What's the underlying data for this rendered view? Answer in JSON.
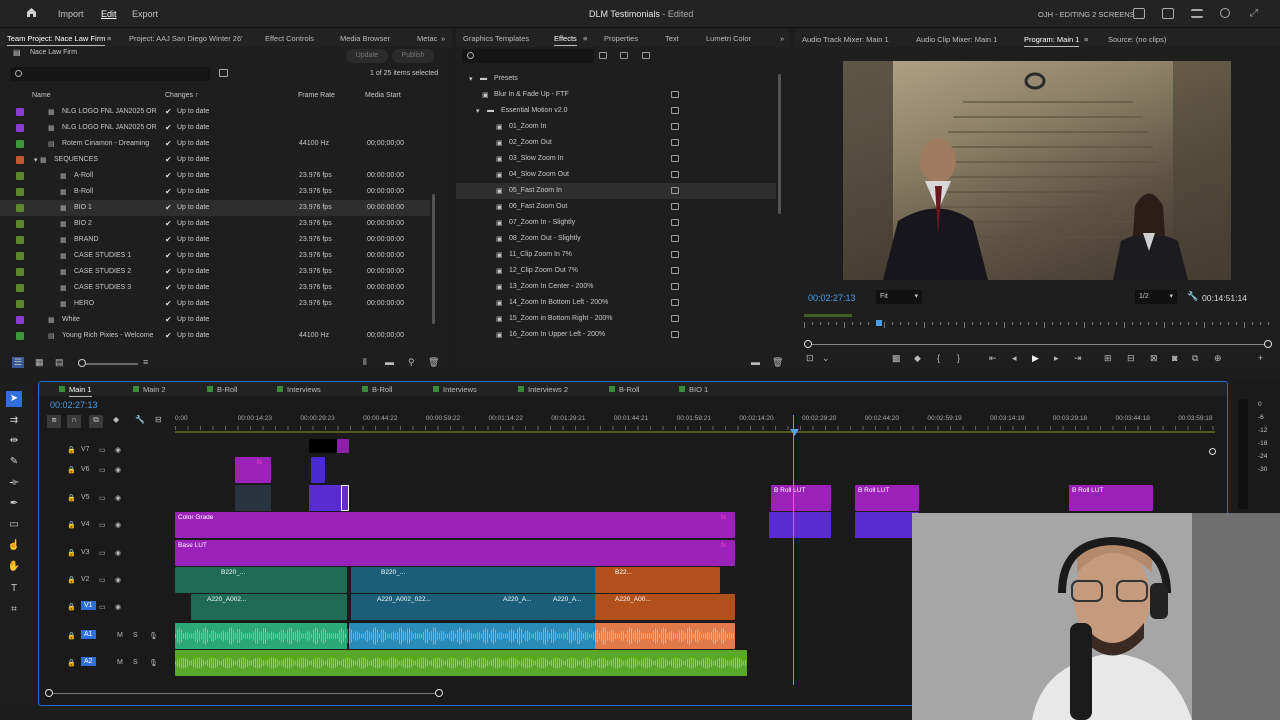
{
  "app": {
    "title": "DLM Testimonials",
    "status": "- Edited",
    "workspace": "OJH - EDITING 2 SCREENS",
    "menu": [
      "Import",
      "Edit",
      "Export"
    ],
    "active_menu": "Edit"
  },
  "project": {
    "tabs": [
      "Team Project: Nace Law Firm",
      "Project: AAJ San Diego Winter 26'",
      "Effect Controls",
      "Media Browser",
      "Metac"
    ],
    "name": "Nace Law Firm",
    "update_label": "Update",
    "publish_label": "Publish",
    "items_selected": "1 of 25 items selected",
    "columns": [
      "Name",
      "Changes",
      "Frame Rate",
      "Media Start"
    ],
    "rows": [
      {
        "name": "NLG LOGO FNL JAN2025 OR",
        "changes": "Up to date",
        "rate": "",
        "start": "",
        "color": "#8a3bd0",
        "indent": 1
      },
      {
        "name": "NLG LOGO FNL JAN2025 OR",
        "changes": "Up to date",
        "rate": "",
        "start": "",
        "color": "#8a3bd0",
        "indent": 1
      },
      {
        "name": "Rotem Cinamon - Dreaming",
        "changes": "Up to date",
        "rate": "44100 Hz",
        "start": "00;00;00;00",
        "color": "#3a9a3a",
        "indent": 1
      },
      {
        "name": "SEQUENCES",
        "changes": "Up to date",
        "rate": "",
        "start": "",
        "color": "#c05a2a",
        "indent": 0
      },
      {
        "name": "A-Roll",
        "changes": "Up to date",
        "rate": "23.976 fps",
        "start": "00:00:00:00",
        "color": "#5a8a2a",
        "indent": 2
      },
      {
        "name": "B-Roll",
        "changes": "Up to date",
        "rate": "23.976 fps",
        "start": "00:00:00:00",
        "color": "#5a8a2a",
        "indent": 2
      },
      {
        "name": "BIO 1",
        "changes": "Up to date",
        "rate": "23.976 fps",
        "start": "00:00:00:00",
        "color": "#5a8a2a",
        "indent": 2
      },
      {
        "name": "BIO 2",
        "changes": "Up to date",
        "rate": "23.976 fps",
        "start": "00:00:00:00",
        "color": "#5a8a2a",
        "indent": 2
      },
      {
        "name": "BRAND",
        "changes": "Up to date",
        "rate": "23.976 fps",
        "start": "00:00:00:00",
        "color": "#5a8a2a",
        "indent": 2
      },
      {
        "name": "CASE STUDIES 1",
        "changes": "Up to date",
        "rate": "23.976 fps",
        "start": "00:00:00:00",
        "color": "#5a8a2a",
        "indent": 2
      },
      {
        "name": "CASE STUDIES 2",
        "changes": "Up to date",
        "rate": "23.976 fps",
        "start": "00:00:00:00",
        "color": "#5a8a2a",
        "indent": 2
      },
      {
        "name": "CASE STUDIES 3",
        "changes": "Up to date",
        "rate": "23.976 fps",
        "start": "00:00:00:00",
        "color": "#5a8a2a",
        "indent": 2
      },
      {
        "name": "HERO",
        "changes": "Up to date",
        "rate": "23.976 fps",
        "start": "00:00:00:00",
        "color": "#5a8a2a",
        "indent": 2
      },
      {
        "name": "White",
        "changes": "Up to date",
        "rate": "",
        "start": "",
        "color": "#8a3bd0",
        "indent": 1
      },
      {
        "name": "Young Rich Pixies - Welcome",
        "changes": "Up to date",
        "rate": "44100 Hz",
        "start": "00;00;00;00",
        "color": "#3a9a3a",
        "indent": 1
      }
    ]
  },
  "effects": {
    "tabs": [
      "Graphics Templates",
      "Effects",
      "Properties",
      "Text",
      "Lumetri Color"
    ],
    "presets_label": "Presets",
    "items": [
      {
        "name": "Blur In & Fade Up - FTF",
        "level": 1
      },
      {
        "name": "Essential Motion v2.0",
        "level": 1
      },
      {
        "name": "01_Zoom In",
        "level": 2
      },
      {
        "name": "02_Zoom Out",
        "level": 2
      },
      {
        "name": "03_Slow Zoom In",
        "level": 2
      },
      {
        "name": "04_Slow Zoom Out",
        "level": 2
      },
      {
        "name": "05_Fast Zoom In",
        "level": 2
      },
      {
        "name": "06_Fast Zoom Out",
        "level": 2
      },
      {
        "name": "07_Zoom In - Slightly",
        "level": 2
      },
      {
        "name": "08_Zoom Out - Slightly",
        "level": 2
      },
      {
        "name": "11_Clip Zoom In 7%",
        "level": 2
      },
      {
        "name": "12_Clip Zoom Out 7%",
        "level": 2
      },
      {
        "name": "13_Zoom In Center - 200%",
        "level": 2
      },
      {
        "name": "14_Zoom In Bottom Left - 200%",
        "level": 2
      },
      {
        "name": "15_Zoom in Bottom Right - 200%",
        "level": 2
      },
      {
        "name": "16_Zoom In Upper Left - 200%",
        "level": 2
      }
    ]
  },
  "program": {
    "tabs": [
      "Audio Track Mixer: Main 1",
      "Audio Clip Mixer: Main 1",
      "Program: Main 1",
      "Source: (no clips)"
    ],
    "timecode": "00:02:27:13",
    "fit": "Fit",
    "resolution": "1/2",
    "duration": "00:14:51:14"
  },
  "timeline": {
    "tabs": [
      "Main 1",
      "Main 2",
      "B-Roll",
      "Interviews",
      "B-Roll",
      "Interviews",
      "Interviews 2",
      "B-Roll",
      "BIO 1"
    ],
    "timecode": "00:02:27:13",
    "ruler": [
      "0:00",
      "00:00:14:23",
      "00:00:29:23",
      "00:00:44:22",
      "00:00:59:22",
      "00:01:14:22",
      "00:01:29:21",
      "00:01:44:21",
      "00:01:59:21",
      "00:02:14:20",
      "00:02:29:20",
      "00:02:44:20",
      "00:02:59:19",
      "00:03:14:19",
      "00:03:29:18",
      "00:03:44:18",
      "00:03:59:18"
    ],
    "tracks": [
      "V7",
      "V6",
      "V5",
      "V4",
      "V3",
      "V2",
      "V1",
      "A1",
      "A2"
    ],
    "track_m": "M",
    "track_s": "S",
    "clips": {
      "color_grade": "Color Grade",
      "base_lut": "Base LUT",
      "broll_lut": "B Roll LUT",
      "fx": "fx",
      "v2a": "B220_...",
      "v2b": "B220_...",
      "v2c": "B22...",
      "v1a": "A220_A002...",
      "v1b": "A220_A002_022...",
      "v1c": "A220_A...",
      "v1d": "A220_A...",
      "v1e": "A220_A00..."
    },
    "meter": [
      "0",
      "-6",
      "-12",
      "-18",
      "-24",
      "-30"
    ]
  }
}
